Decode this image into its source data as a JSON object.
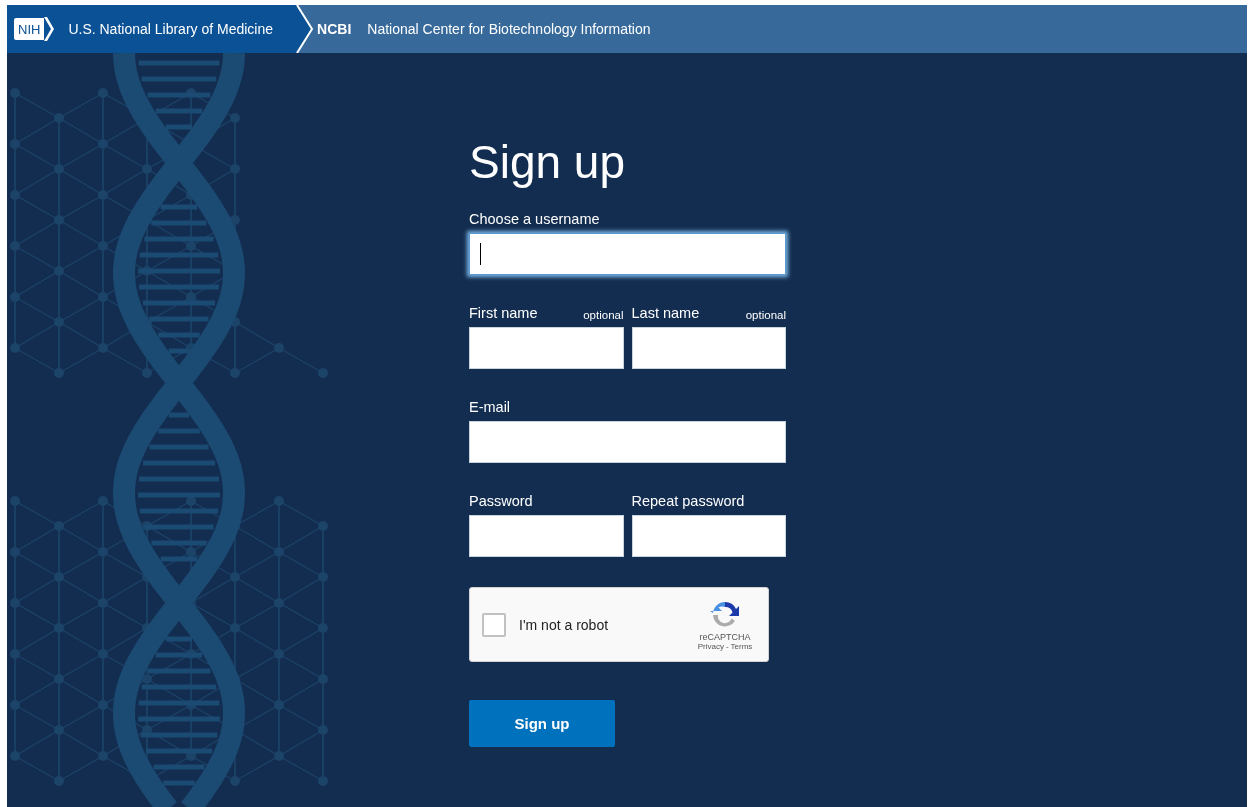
{
  "header": {
    "logo": "NIH",
    "library": "U.S. National Library of Medicine",
    "ncbi_short": "NCBI",
    "ncbi_full": "National Center for Biotechnology Information"
  },
  "form": {
    "title": "Sign up",
    "rows": [
      {
        "fields": [
          {
            "label": "Choose a username",
            "focused": true
          }
        ]
      },
      {
        "fields": [
          {
            "label": "First name",
            "note": "optional",
            "focused": false
          },
          {
            "label": "Last name",
            "note": "optional",
            "focused": false
          }
        ]
      },
      {
        "fields": [
          {
            "label": "E-mail",
            "focused": false
          }
        ]
      },
      {
        "fields": [
          {
            "label": "Password",
            "focused": false
          },
          {
            "label": "Repeat password",
            "focused": false
          }
        ]
      }
    ],
    "captcha": {
      "checked": false,
      "label": "I'm not a robot",
      "brand": "reCAPTCHA",
      "privacy": "Privacy",
      "separator": "-",
      "terms": "Terms"
    },
    "submit": "Sign up"
  }
}
